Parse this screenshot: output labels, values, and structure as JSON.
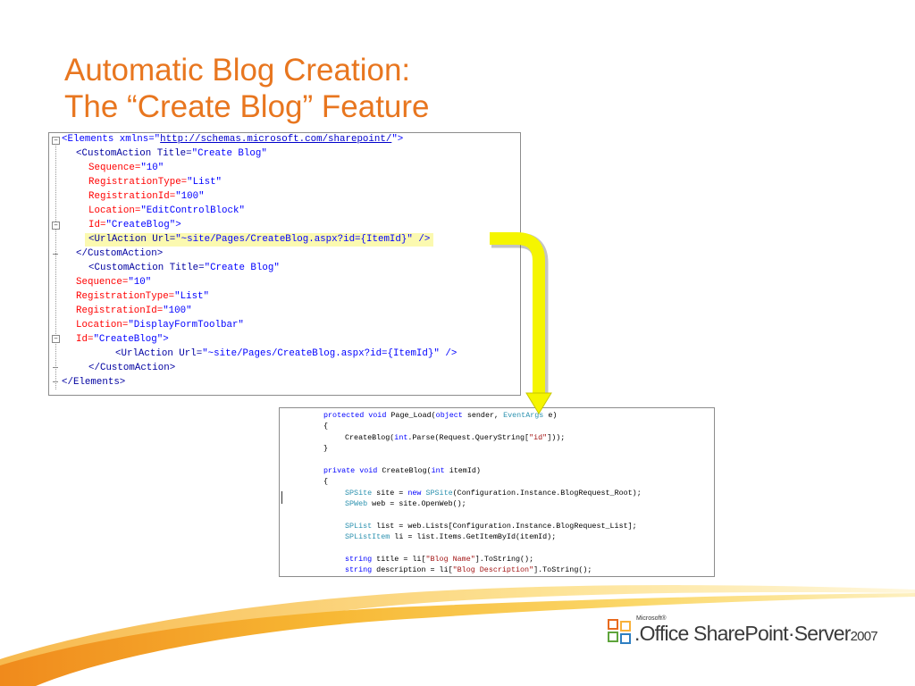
{
  "slide": {
    "title_line1": "Automatic Blog Creation:",
    "title_line2": "The “Create Blog” Feature"
  },
  "xml_code": {
    "l1": {
      "a": "<Elements xmlns=\"",
      "url": "http://schemas.microsoft.com/sharepoint/",
      "b": "\">"
    },
    "l2": {
      "a": "<CustomAction Title=",
      "v": "\"Create Blog\""
    },
    "l3": {
      "a": "Sequence=",
      "v": "\"10\""
    },
    "l4": {
      "a": "RegistrationType=",
      "v": "\"List\""
    },
    "l5": {
      "a": "RegistrationId=",
      "v": "\"100\""
    },
    "l6": {
      "a": "Location=",
      "v": "\"EditControlBlock\""
    },
    "l7": {
      "a": "Id=",
      "v": "\"CreateBlog\"",
      "b": ">"
    },
    "l8": {
      "a": "<UrlAction Url=",
      "v": "\"~site/Pages/CreateBlog.aspx?id={ItemId}\"",
      "b": " />"
    },
    "l9": {
      "a": "</CustomAction>"
    },
    "l10": {
      "a": "<CustomAction Title=",
      "v": "\"Create Blog\""
    },
    "l11": {
      "a": "Sequence=",
      "v": "\"10\""
    },
    "l12": {
      "a": "RegistrationType=",
      "v": "\"List\""
    },
    "l13": {
      "a": "RegistrationId=",
      "v": "\"100\""
    },
    "l14": {
      "a": "Location=",
      "v": "\"DisplayFormToolbar\""
    },
    "l15": {
      "a": "Id=",
      "v": "\"CreateBlog\"",
      "b": ">"
    },
    "l16": {
      "a": "<UrlAction Url=",
      "v": "\"~site/Pages/CreateBlog.aspx?id={ItemId}\"",
      "b": " />"
    },
    "l17": {
      "a": "</CustomAction>"
    },
    "l18": {
      "a": "</Elements>"
    }
  },
  "cs_code": {
    "c1": {
      "k1": "protected void",
      "t1": " Page_Load(",
      "k2": "object",
      "t2": " sender, ",
      "ty": "EventArgs",
      "t3": " e)"
    },
    "c2": "{",
    "c3": {
      "t1": "CreateBlog(",
      "k1": "int",
      "t2": ".Parse(Request.QueryString[",
      "s": "\"id\"",
      "t3": "]));"
    },
    "c4": "}",
    "c5": {
      "k1": "private void",
      "t1": " CreateBlog(",
      "k2": "int",
      "t2": " itemId)"
    },
    "c6": "{",
    "c7": {
      "ty1": "SPSite",
      "t1": " site = ",
      "k": "new",
      "t2": " ",
      "ty2": "SPSite",
      "t3": "(Configuration.Instance.BlogRequest_Root);"
    },
    "c8": {
      "ty": "SPWeb",
      "t": " web = site.OpenWeb();"
    },
    "c9": {
      "ty": "SPList",
      "t": " list = web.Lists[Configuration.Instance.BlogRequest_List];"
    },
    "c10": {
      "ty": "SPListItem",
      "t": " li = list.Items.GetItemById(itemId);"
    },
    "c11": {
      "k": "string",
      "t1": " title = li[",
      "s": "\"Blog Name\"",
      "t2": "].ToString();"
    },
    "c12": {
      "k": "string",
      "t1": " description = li[",
      "s": "\"Blog Description\"",
      "t2": "].ToString();"
    }
  },
  "logo": {
    "microsoft": "Microsoft®",
    "product": ".Office SharePoint·Server",
    "year": "2007"
  },
  "colors": {
    "title": "#e8761f",
    "arrow": "#f5f500",
    "keyword": "#0000ff",
    "type": "#2b91af",
    "string": "#a31515"
  }
}
